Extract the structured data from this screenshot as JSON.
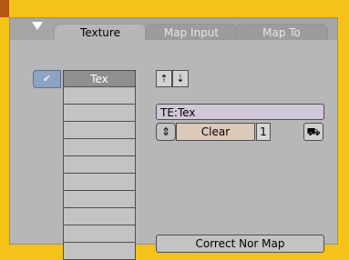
{
  "tabs": [
    {
      "label": "Texture",
      "active": true
    },
    {
      "label": "Map Input",
      "active": false
    },
    {
      "label": "Map To",
      "active": false
    }
  ],
  "texture_list": {
    "active_check": "✔",
    "slots": [
      "Tex",
      "",
      "",
      "",
      "",
      "",
      "",
      "",
      "",
      "",
      ""
    ]
  },
  "move_buttons": {
    "up": "⇡",
    "down": "⇣"
  },
  "datablock": {
    "name": "TE:Tex",
    "stepper_icon": "⇕",
    "clear_label": "Clear",
    "users": "1",
    "fake_user_icon": "⛟"
  },
  "correct_nor_map_label": "Correct Nor Map",
  "colors": {
    "background": "#f5c21a",
    "panel": "#b7b7b7",
    "accent": "#8ea3c4"
  }
}
